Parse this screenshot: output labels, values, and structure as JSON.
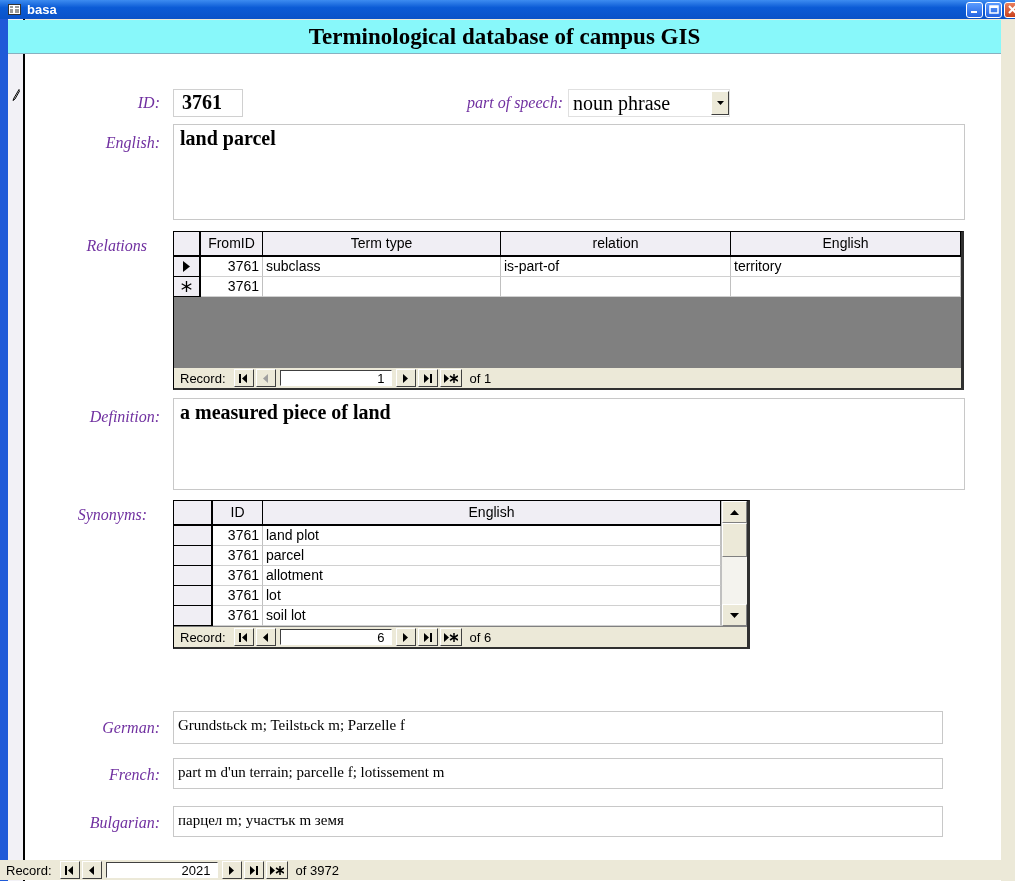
{
  "window": {
    "title": "basa"
  },
  "header": {
    "title": "Terminological database of campus GIS"
  },
  "id_field": {
    "label": "ID:",
    "value": "3761"
  },
  "part_of_speech": {
    "label": "part of speech:",
    "value": "noun phrase"
  },
  "english": {
    "label": "English:",
    "value": "land parcel"
  },
  "relations": {
    "label": "Relations",
    "columns": [
      "FromID",
      "Term type",
      "relation",
      "English"
    ],
    "rows": [
      {
        "kind": "record",
        "selected": true,
        "cells": [
          "3761",
          "subclass",
          "is-part-of",
          "territory"
        ]
      },
      {
        "kind": "new",
        "selected": false,
        "cells": [
          "3761"
        ]
      }
    ],
    "navigator": {
      "label": "Record:",
      "current": "1",
      "total": "of 1",
      "previous_disabled": true
    }
  },
  "definition": {
    "label": "Definition:",
    "value": "a measured piece of land"
  },
  "synonyms": {
    "label": "Synonyms:",
    "columns": [
      "ID",
      "English"
    ],
    "rows": [
      {
        "selected": false,
        "cells": [
          "3761",
          "land plot"
        ]
      },
      {
        "selected": false,
        "cells": [
          "3761",
          "parcel"
        ]
      },
      {
        "selected": false,
        "cells": [
          "3761",
          "allotment"
        ]
      },
      {
        "selected": false,
        "cells": [
          "3761",
          "lot"
        ]
      },
      {
        "selected": false,
        "cells": [
          "3761",
          "soil lot"
        ]
      }
    ],
    "navigator": {
      "label": "Record:",
      "current": "6",
      "total": "of 6",
      "previous_disabled": false
    }
  },
  "german": {
    "label": "German:",
    "value": "Grundstьck m; Teilstьck m; Parzelle f"
  },
  "french": {
    "label": "French:",
    "value": "part m d'un terrain; parcelle f; lotissement m"
  },
  "bulgarian": {
    "label": "Bulgarian:",
    "value": "парцел m; участък m земя"
  },
  "record_navigator": {
    "label": "Record:",
    "current": "2021",
    "total": "of 3972",
    "previous_disabled": false
  }
}
